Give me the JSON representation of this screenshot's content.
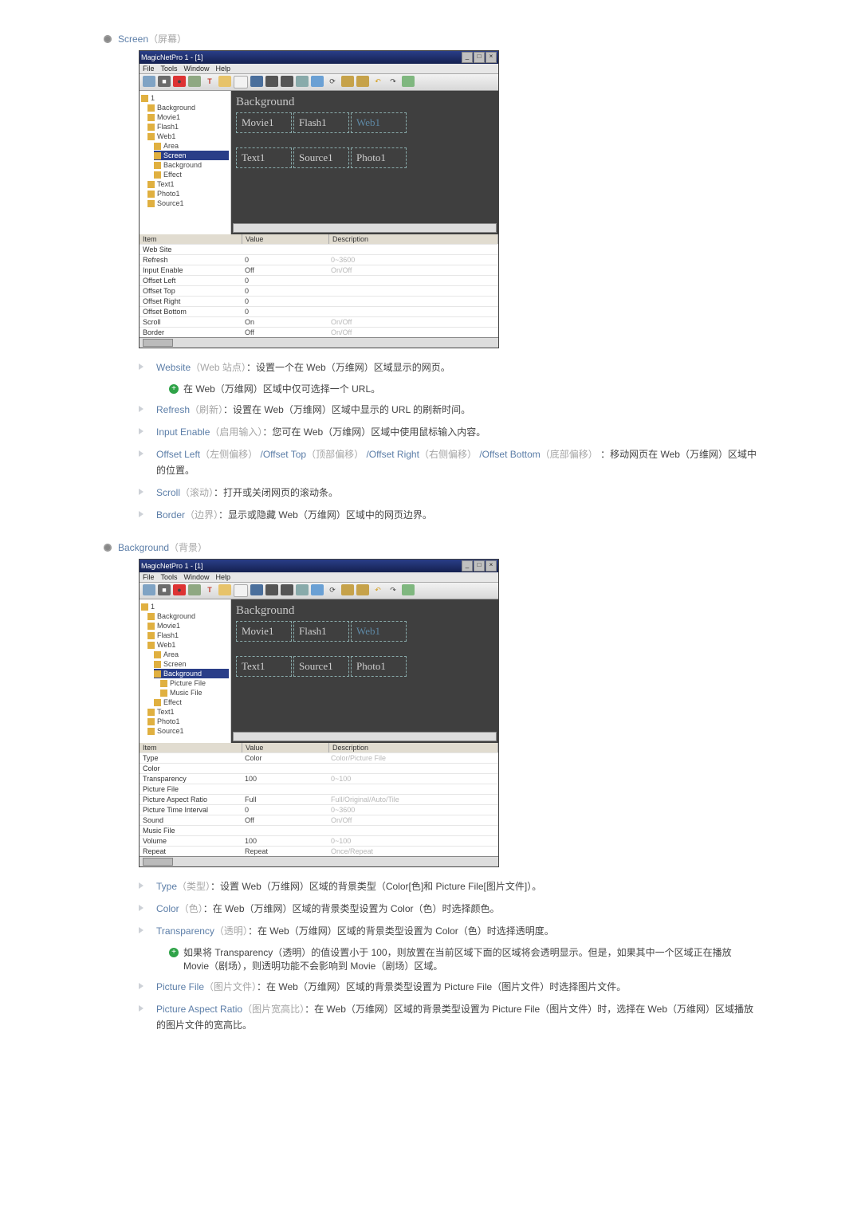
{
  "sections": {
    "screen_heading": "Screen",
    "screen_heading_zh": "（屏幕）",
    "background_heading": "Background",
    "background_heading_zh": "（背景）"
  },
  "shot": {
    "title": "MagicNetPro 1 - [1]",
    "menu": [
      "File",
      "Tools",
      "Window",
      "Help"
    ],
    "bg_label": "Background",
    "tiles_row1": [
      "Movie1",
      "Flash1",
      "Web1"
    ],
    "tiles_row2": [
      "Text1",
      "Source1",
      "Photo1"
    ],
    "columns": {
      "c1": "Item",
      "c2": "Value",
      "c3": "Description"
    }
  },
  "tree1": [
    {
      "t": "1",
      "cl": ""
    },
    {
      "t": "Background",
      "cl": "indent1"
    },
    {
      "t": "Movie1",
      "cl": "indent1"
    },
    {
      "t": "Flash1",
      "cl": "indent1"
    },
    {
      "t": "Web1",
      "cl": "indent1"
    },
    {
      "t": "Area",
      "cl": "indent2"
    },
    {
      "t": "Screen",
      "cl": "indent2 sel"
    },
    {
      "t": "Background",
      "cl": "indent2"
    },
    {
      "t": "Effect",
      "cl": "indent2"
    },
    {
      "t": "Text1",
      "cl": "indent1"
    },
    {
      "t": "Photo1",
      "cl": "indent1"
    },
    {
      "t": "Source1",
      "cl": "indent1"
    }
  ],
  "tree2": [
    {
      "t": "1",
      "cl": ""
    },
    {
      "t": "Background",
      "cl": "indent1"
    },
    {
      "t": "Movie1",
      "cl": "indent1"
    },
    {
      "t": "Flash1",
      "cl": "indent1"
    },
    {
      "t": "Web1",
      "cl": "indent1"
    },
    {
      "t": "Area",
      "cl": "indent2"
    },
    {
      "t": "Screen",
      "cl": "indent2"
    },
    {
      "t": "Background",
      "cl": "indent2 sel"
    },
    {
      "t": "Picture File",
      "cl": "indent3"
    },
    {
      "t": "Music File",
      "cl": "indent3"
    },
    {
      "t": "Effect",
      "cl": "indent2"
    },
    {
      "t": "Text1",
      "cl": "indent1"
    },
    {
      "t": "Photo1",
      "cl": "indent1"
    },
    {
      "t": "Source1",
      "cl": "indent1"
    }
  ],
  "props1": [
    {
      "k": "Web Site",
      "v": "",
      "d": ""
    },
    {
      "k": "Refresh",
      "v": "0",
      "d": "0~3600"
    },
    {
      "k": "Input Enable",
      "v": "Off",
      "d": "On/Off"
    },
    {
      "k": "Offset Left",
      "v": "0",
      "d": ""
    },
    {
      "k": "Offset Top",
      "v": "0",
      "d": ""
    },
    {
      "k": "Offset Right",
      "v": "0",
      "d": ""
    },
    {
      "k": "Offset Bottom",
      "v": "0",
      "d": ""
    },
    {
      "k": "Scroll",
      "v": "On",
      "d": "On/Off"
    },
    {
      "k": "Border",
      "v": "Off",
      "d": "On/Off"
    }
  ],
  "props2": [
    {
      "k": "Type",
      "v": "Color",
      "d": "Color/Picture File"
    },
    {
      "k": "Color",
      "v": "",
      "d": ""
    },
    {
      "k": "Transparency",
      "v": "100",
      "d": "0~100"
    },
    {
      "k": "Picture File",
      "v": "",
      "d": ""
    },
    {
      "k": "Picture Aspect Ratio",
      "v": "Full",
      "d": "Full/Original/Auto/Tile"
    },
    {
      "k": "Picture Time Interval",
      "v": "0",
      "d": "0~3600"
    },
    {
      "k": "Sound",
      "v": "Off",
      "d": "On/Off"
    },
    {
      "k": "Music File",
      "v": "",
      "d": ""
    },
    {
      "k": "Volume",
      "v": "100",
      "d": "0~100"
    },
    {
      "k": "Repeat",
      "v": "Repeat",
      "d": "Once/Repeat"
    }
  ],
  "list_screen": {
    "website": {
      "t": "Website",
      "tz": "（Web 站点）",
      "rest": "：设置一个在 Web（万维网）区域显示的网页。"
    },
    "website_sub": "在 Web（万维网）区域中仅可选择一个 URL。",
    "refresh": {
      "t": "Refresh",
      "tz": "（刷新）",
      "rest": "：设置在 Web（万维网）区域中显示的 URL 的刷新时间。"
    },
    "input": {
      "t": "Input Enable",
      "tz": "（启用输入）",
      "rest": "：您可在 Web（万维网）区域中使用鼠标输入内容。"
    },
    "offset_a": "Offset Left",
    "offset_az": "（左侧偏移）",
    "offset_b": "/Offset Top",
    "offset_bz": "（顶部偏移）",
    "offset_c": "/Offset Right",
    "offset_cz": "（右侧偏移）",
    "offset_d": "/Offset Bottom",
    "offset_dz": "（底部偏移）",
    "offset_rest": "：移动网页在 Web（万维网）区域中的位置。",
    "scroll": {
      "t": "Scroll",
      "tz": "（滚动）",
      "rest": "：打开或关闭网页的滚动条。"
    },
    "border": {
      "t": "Border",
      "tz": "（边界）",
      "rest": "：显示或隐藏 Web（万维网）区域中的网页边界。"
    }
  },
  "list_bg": {
    "type": {
      "t": "Type",
      "tz": "（类型）",
      "rest": "：设置 Web（万维网）区域的背景类型（Color[色]和 Picture File[图片文件]）。"
    },
    "color": {
      "t": "Color",
      "tz": "（色）",
      "rest": "：在 Web（万维网）区域的背景类型设置为 Color（色）时选择颜色。"
    },
    "trans": {
      "t": "Transparency",
      "tz": "（透明）",
      "rest": "：在 Web（万维网）区域的背景类型设置为 Color（色）时选择透明度。"
    },
    "trans_sub": "如果将 Transparency（透明）的值设置小于 100，则放置在当前区域下面的区域将会透明显示。但是，如果其中一个区域正在播放 Movie（剧场），则透明功能不会影响到 Movie（剧场）区域。",
    "pfile": {
      "t": "Picture File",
      "tz": "（图片文件）",
      "rest": "：在 Web（万维网）区域的背景类型设置为 Picture File（图片文件）时选择图片文件。"
    },
    "par_a": "Picture Aspect Ratio",
    "par_az": "（图片宽高比）",
    "par_rest": "：在 Web（万维网）区域的背景类型设置为 Picture File（图片文件）时，选择在 Web（万维网）区域播放的图片文件的宽高比。"
  },
  "icons": {
    "min": "_",
    "max": "□",
    "close": "×"
  }
}
